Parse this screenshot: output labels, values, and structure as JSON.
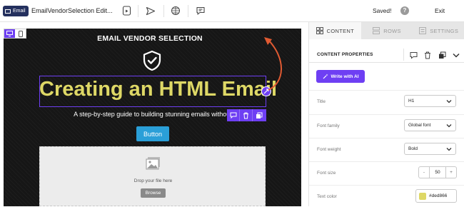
{
  "topbar": {
    "badge_label": "Email",
    "document_title": "EmailVendorSelection Edit...",
    "status": "Saved!",
    "help_label": "?",
    "exit_label": "Exit",
    "icons": [
      "preview-icon",
      "send-icon",
      "language-icon",
      "comment-icon"
    ]
  },
  "email": {
    "heading": "EMAIL VENDOR SELECTION",
    "title": "Creating an HTML Email",
    "subtitle": "A step-by-step guide to building stunning emails without code",
    "button_label": "Button",
    "dropzone_text": "Drop your file here",
    "browse_label": "Browse",
    "title_color": "#ded866",
    "button_color": "#2a9fd8"
  },
  "panel": {
    "tabs": [
      {
        "label": "CONTENT",
        "icon": "grid-icon",
        "active": true
      },
      {
        "label": "ROWS",
        "icon": "rows-icon",
        "active": false
      },
      {
        "label": "SETTINGS",
        "icon": "settings-icon",
        "active": false
      }
    ],
    "section_title": "CONTENT PROPERTIES",
    "ai_button_label": "Write with AI",
    "properties": {
      "title_label": "Title",
      "title_value": "H1",
      "font_family_label": "Font family",
      "font_family_value": "Global font",
      "font_weight_label": "Font weight",
      "font_weight_value": "Bold",
      "font_size_label": "Font size",
      "font_size_value": "50",
      "font_size_minus": "-",
      "font_size_plus": "+",
      "text_color_label": "Text color",
      "text_color_value": "#ded866"
    }
  },
  "accent_color": "#6e3ff3"
}
